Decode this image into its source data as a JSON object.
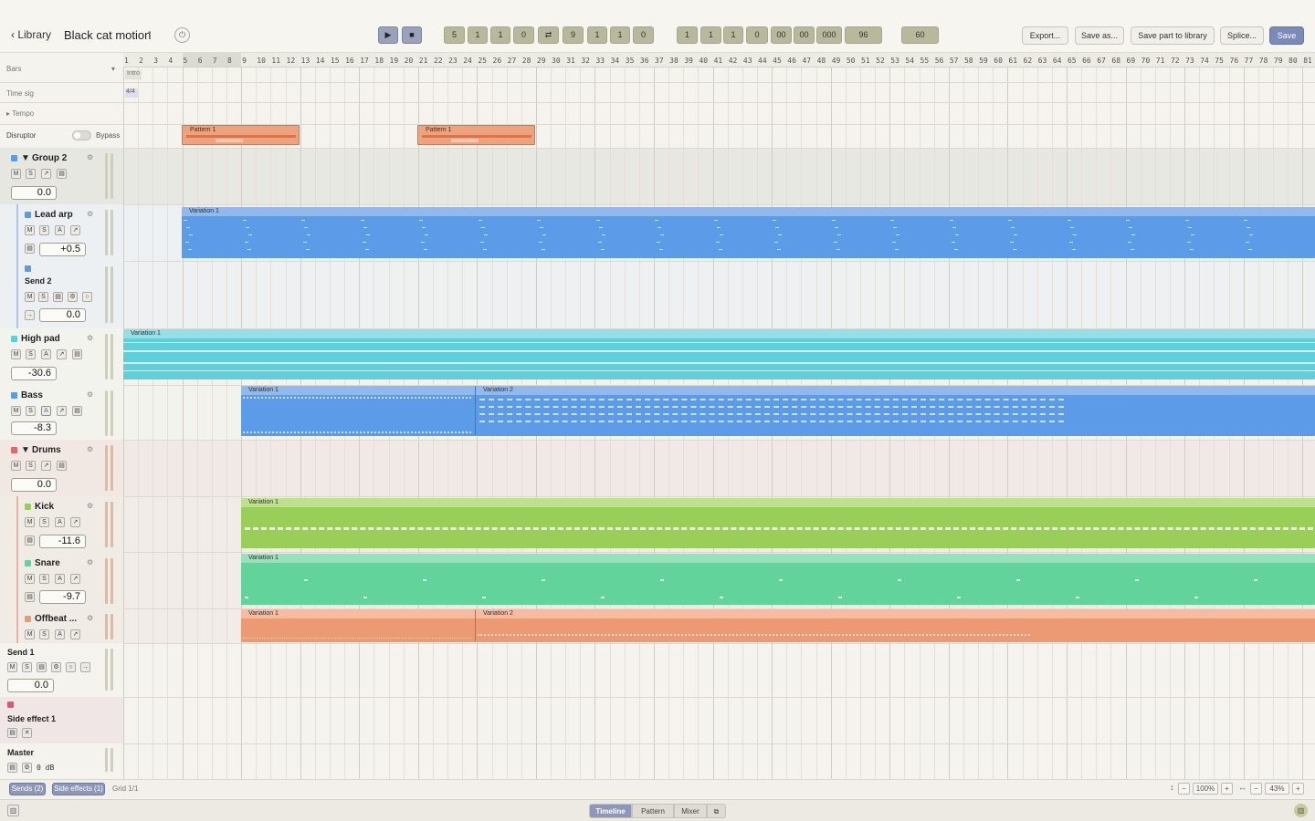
{
  "header": {
    "back_label": "Library",
    "title": "Black cat motion",
    "modified_dot": "•",
    "play_icon": "play-icon",
    "stop_icon": "stop-icon",
    "power_icon": "power-icon",
    "loop_icon": "loop-icon",
    "pos_start": [
      "5",
      "1",
      "1",
      "0"
    ],
    "pos_end": [
      "9",
      "1",
      "1",
      "0"
    ],
    "counter": [
      "1",
      "1",
      "1",
      "0",
      "00",
      "00",
      "000",
      "96"
    ],
    "tempo": "60",
    "actions": [
      "Export...",
      "Save as...",
      "Save part to library",
      "Splice...",
      "Save"
    ]
  },
  "ruler": {
    "bars": [
      "1",
      "2",
      "3",
      "4",
      "5",
      "6",
      "7",
      "8",
      "9",
      "10",
      "11",
      "12",
      "13",
      "14",
      "15",
      "16",
      "17",
      "18",
      "19",
      "20",
      "21",
      "22",
      "23",
      "24",
      "25",
      "26",
      "27",
      "28",
      "29",
      "30",
      "31",
      "32",
      "33",
      "34",
      "35",
      "36",
      "37",
      "38",
      "39",
      "40",
      "41",
      "42",
      "43",
      "44",
      "45",
      "46",
      "47",
      "48",
      "49",
      "50",
      "51",
      "52",
      "53",
      "54",
      "55",
      "56",
      "57",
      "58",
      "59",
      "60",
      "61",
      "62",
      "63",
      "64",
      "65",
      "66",
      "67",
      "68",
      "69",
      "70",
      "71",
      "72",
      "73",
      "74",
      "75",
      "76",
      "77",
      "78",
      "79",
      "80",
      "81"
    ]
  },
  "global": {
    "bars_label": "Bars",
    "section_label": "Intro",
    "timesig_label": "Time sig",
    "timesig_value": "4/4",
    "tempo_label": "Tempo",
    "disruptor_label": "Disruptor",
    "bypass_label": "Bypass"
  },
  "tracks": {
    "group2": {
      "name": "Group 2",
      "vol": "0.0"
    },
    "leadarp": {
      "name": "Lead arp",
      "vol": "+0.5"
    },
    "send2": {
      "name": "Send 2",
      "vol": "0.0"
    },
    "highpad": {
      "name": "High pad",
      "vol": "-30.6"
    },
    "bass": {
      "name": "Bass",
      "vol": "-8.3"
    },
    "drums": {
      "name": "Drums",
      "vol": "0.0"
    },
    "kick": {
      "name": "Kick",
      "vol": "-11.6"
    },
    "snare": {
      "name": "Snare",
      "vol": "-9.7"
    },
    "offbeat": {
      "name": "Offbeat ..."
    },
    "send1": {
      "name": "Send 1",
      "vol": "0.0"
    },
    "sidefx": {
      "name": "Side effect 1"
    },
    "master": {
      "name": "Master",
      "vol": "0 dB"
    }
  },
  "btn": {
    "m": "M",
    "s": "S",
    "a": "A"
  },
  "clips": {
    "pattern1": "Pattern 1",
    "variation1": "Variation 1",
    "variation2": "Variation 2"
  },
  "bottom": {
    "sends": "Sends (2)",
    "side_effects": "Side effects (1)",
    "grid": "Grid 1/1",
    "zoom_v": "100%",
    "zoom_h": "43%"
  },
  "footer": {
    "tabs": [
      "Timeline",
      "Pattern",
      "Mixer"
    ]
  },
  "colors": {
    "pattern": "#eea37f",
    "leadarp": "#5b9be8",
    "highpad": "#5fcfdc",
    "bass": "#5b9be8",
    "kick": "#99cf58",
    "snare": "#62d39a",
    "offbeat": "#ec9a74"
  }
}
